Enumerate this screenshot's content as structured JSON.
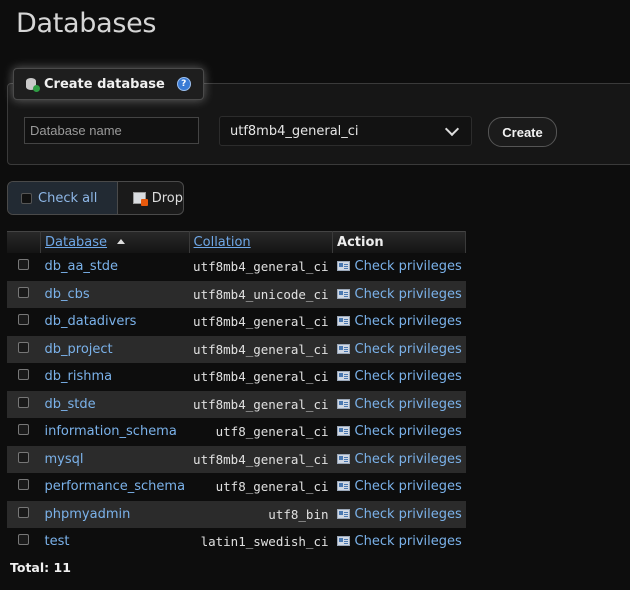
{
  "page": {
    "title": "Databases"
  },
  "create": {
    "legend": "Create database",
    "name_placeholder": "Database name",
    "collation": "utf8mb4_general_ci",
    "create_label": "Create"
  },
  "actions": {
    "check_all": "Check all",
    "drop": "Drop"
  },
  "table": {
    "headers": {
      "database": "Database",
      "collation": "Collation",
      "action": "Action"
    },
    "rows": [
      {
        "database": "db_aa_stde",
        "collation": "utf8mb4_general_ci",
        "action": "Check privileges"
      },
      {
        "database": "db_cbs",
        "collation": "utf8mb4_unicode_ci",
        "action": "Check privileges"
      },
      {
        "database": "db_datadivers",
        "collation": "utf8mb4_general_ci",
        "action": "Check privileges"
      },
      {
        "database": "db_project",
        "collation": "utf8mb4_general_ci",
        "action": "Check privileges"
      },
      {
        "database": "db_rishma",
        "collation": "utf8mb4_general_ci",
        "action": "Check privileges"
      },
      {
        "database": "db_stde",
        "collation": "utf8mb4_general_ci",
        "action": "Check privileges"
      },
      {
        "database": "information_schema",
        "collation": "utf8_general_ci",
        "action": "Check privileges"
      },
      {
        "database": "mysql",
        "collation": "utf8mb4_general_ci",
        "action": "Check privileges"
      },
      {
        "database": "performance_schema",
        "collation": "utf8_general_ci",
        "action": "Check privileges"
      },
      {
        "database": "phpmyadmin",
        "collation": "utf8_bin",
        "action": "Check privileges"
      },
      {
        "database": "test",
        "collation": "latin1_swedish_ci",
        "action": "Check privileges"
      }
    ]
  },
  "total": "Total: 11"
}
